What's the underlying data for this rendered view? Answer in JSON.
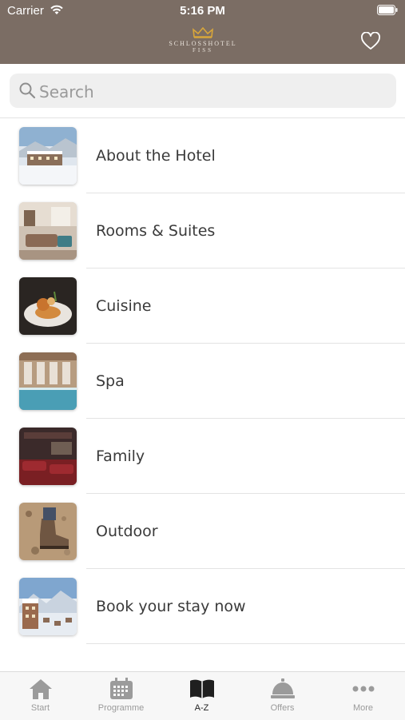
{
  "status_bar": {
    "carrier": "Carrier",
    "time": "5:16 PM"
  },
  "header": {
    "logo_line1": "SCHLOSSHOTEL",
    "logo_line2": "FISS",
    "brand_color": "#7b6d64"
  },
  "search": {
    "placeholder": "Search"
  },
  "list": {
    "items": [
      {
        "label": "About the Hotel",
        "thumb": "snowy-hotel"
      },
      {
        "label": "Rooms & Suites",
        "thumb": "hotel-room"
      },
      {
        "label": "Cuisine",
        "thumb": "plated-dish"
      },
      {
        "label": "Spa",
        "thumb": "indoor-pool"
      },
      {
        "label": "Family",
        "thumb": "cinema-room"
      },
      {
        "label": "Outdoor",
        "thumb": "hiking-boot"
      },
      {
        "label": "Book your stay now",
        "thumb": "alpine-village"
      }
    ]
  },
  "tabbar": {
    "tabs": [
      {
        "label": "Start",
        "icon": "home-icon"
      },
      {
        "label": "Programme",
        "icon": "calendar-icon"
      },
      {
        "label": "A-Z",
        "icon": "book-icon",
        "active": true
      },
      {
        "label": "Offers",
        "icon": "bell-icon"
      },
      {
        "label": "More",
        "icon": "more-icon"
      }
    ]
  }
}
